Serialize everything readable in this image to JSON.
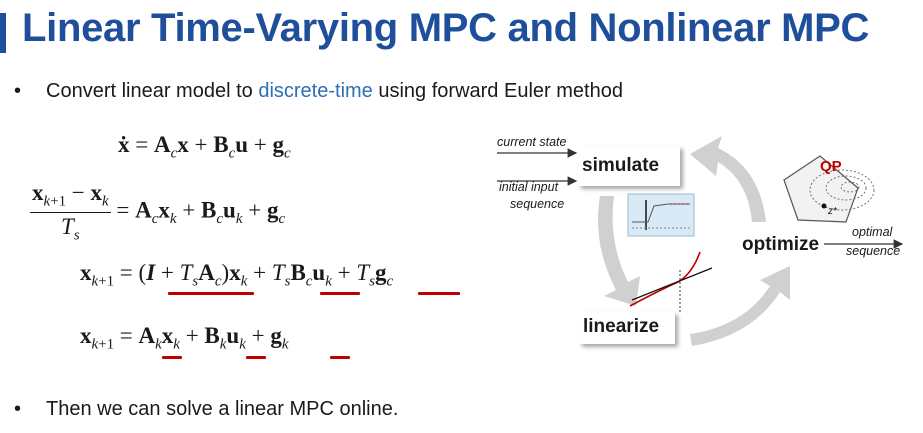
{
  "title": "Linear Time-Varying MPC and Nonlinear MPC",
  "bullets": [
    {
      "marker": "•",
      "before": "Convert linear model to ",
      "highlight": "discrete-time",
      "after": " using forward Euler method"
    },
    {
      "marker": "•",
      "text": "Then we can solve a linear MPC online."
    }
  ],
  "diagram": {
    "simulate": "simulate",
    "linearize": "linearize",
    "optimize": "optimize",
    "current_state": "current state",
    "initial_input": "initial input",
    "sequence": "sequence",
    "optimal": "optimal",
    "optimal_sequence": "sequence",
    "qp": "QP",
    "z_star": "z*"
  },
  "colors": {
    "title": "#1f4e9a",
    "highlight": "#2f6eb5",
    "underline": "#c00000",
    "arrow": "#d0d0d0",
    "qp": "#c00000"
  }
}
